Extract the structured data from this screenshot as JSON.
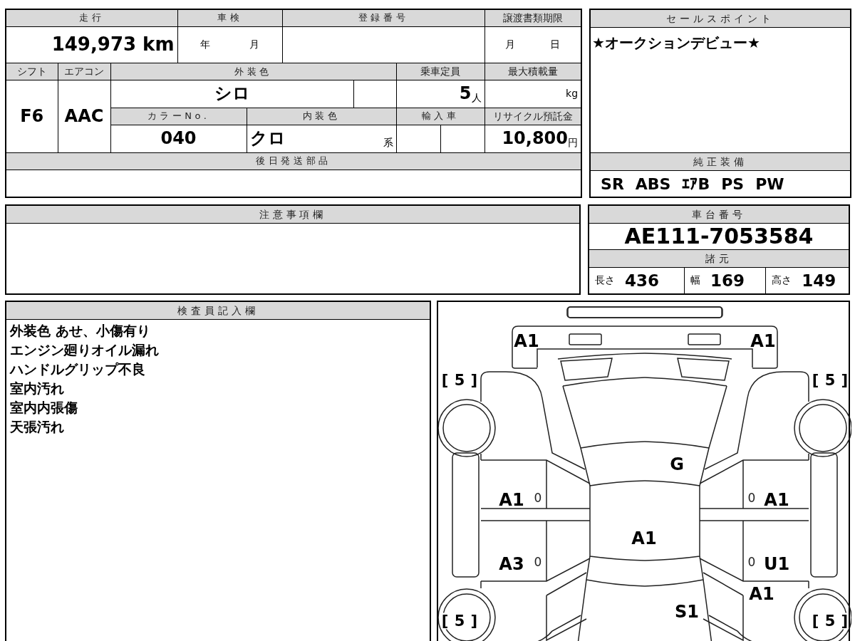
{
  "vehicle_table": {
    "mileage_label": "走行",
    "mileage": "149,973 km",
    "inspection_label": "車検",
    "inspection_year_unit": "年",
    "inspection_month_unit": "月",
    "registration_label": "登録番号",
    "transfer_deadline_label": "譲渡書類期限",
    "transfer_month_unit": "月",
    "transfer_day_unit": "日",
    "shift_label": "シフト",
    "shift": "F6",
    "aircon_label": "エアコン",
    "aircon": "AAC",
    "exterior_color_label": "外装色",
    "exterior_color": "シロ",
    "capacity_label": "乗車定員",
    "capacity": "5",
    "capacity_unit": "人",
    "max_load_label": "最大積載量",
    "max_load_unit": "kg",
    "color_no_label": "カラーNo.",
    "color_no": "040",
    "interior_color_label": "内装色",
    "interior_color": "クロ",
    "interior_color_suffix": "系",
    "import_label": "輸入車",
    "recycle_fee_label": "リサイクル預託金",
    "recycle_fee": "10,800",
    "recycle_fee_unit": "円",
    "parts_to_ship_label": "後日発送部品"
  },
  "sales_points": {
    "title": "セールスポイント",
    "text": "★オークションデビュー★"
  },
  "standard_equipment": {
    "title": "純正装備",
    "items": [
      "SR",
      "ABS",
      "ｴｱB",
      "PS",
      "PW"
    ]
  },
  "notes": {
    "title": "注意事項欄"
  },
  "chassis_number": {
    "title": "車台番号",
    "value": "AE111-7053584"
  },
  "dimensions": {
    "title": "諸元",
    "items": [
      {
        "label": "長さ",
        "value": "436"
      },
      {
        "label": "幅",
        "value": "169"
      },
      {
        "label": "高さ",
        "value": "149"
      }
    ]
  },
  "inspector_notes": {
    "title": "検査員記入欄",
    "lines": [
      "外装色 あせ、小傷有り",
      "エンジン廻りオイル漏れ",
      "ハンドルグリップ不良",
      "室内汚れ",
      "室内内張傷",
      "天張汚れ"
    ]
  },
  "damage_diagram": {
    "marks": [
      {
        "text": "A1",
        "kind": "grade"
      },
      {
        "text": "A1",
        "kind": "grade"
      },
      {
        "text": "[ 5 ]",
        "kind": "tread"
      },
      {
        "text": "[ 5 ]",
        "kind": "tread"
      },
      {
        "text": "G",
        "kind": "grade"
      },
      {
        "text": "A1",
        "kind": "grade"
      },
      {
        "text": "0",
        "kind": "count"
      },
      {
        "text": "0",
        "kind": "count"
      },
      {
        "text": "A1",
        "kind": "grade"
      },
      {
        "text": "A1",
        "kind": "grade"
      },
      {
        "text": "A3",
        "kind": "grade"
      },
      {
        "text": "0",
        "kind": "count"
      },
      {
        "text": "0",
        "kind": "count"
      },
      {
        "text": "U1",
        "kind": "grade"
      },
      {
        "text": "A1",
        "kind": "grade"
      },
      {
        "text": "S1",
        "kind": "grade"
      },
      {
        "text": "[ 5 ]",
        "kind": "tread"
      },
      {
        "text": "[ 5 ]",
        "kind": "tread"
      }
    ]
  }
}
